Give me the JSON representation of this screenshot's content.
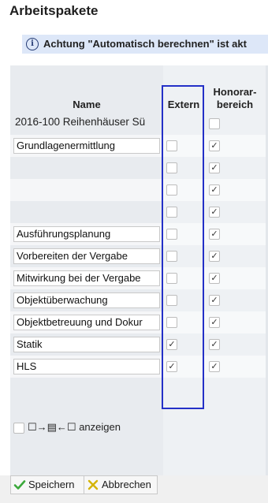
{
  "panel": {
    "title": "Arbeitspakete"
  },
  "info": {
    "icon": "info-icon",
    "text": "Achtung \"Automatisch berechnen\" ist akt"
  },
  "table": {
    "headers": {
      "name": "Name",
      "extern": "Extern",
      "honorar": "Honorar-\nbereich"
    },
    "rows": [
      {
        "name": "2016-100 Reihenhäuser Sü",
        "editable": false,
        "extern": false,
        "honorar": false
      },
      {
        "name": "Grundlagenermittlung",
        "editable": true,
        "extern": false,
        "honorar": true
      },
      {
        "name": "",
        "editable": false,
        "extern": false,
        "honorar": true
      },
      {
        "name": "",
        "editable": false,
        "extern": false,
        "honorar": true
      },
      {
        "name": "",
        "editable": false,
        "extern": false,
        "honorar": true
      },
      {
        "name": "Ausführungsplanung",
        "editable": true,
        "extern": false,
        "honorar": true
      },
      {
        "name": "Vorbereiten der Vergabe",
        "editable": true,
        "extern": false,
        "honorar": true
      },
      {
        "name": "Mitwirkung bei der Vergabe",
        "editable": true,
        "extern": false,
        "honorar": true
      },
      {
        "name": "Objektüberwachung",
        "editable": true,
        "extern": false,
        "honorar": true
      },
      {
        "name": "Objektbetreuung und Dokur",
        "editable": true,
        "extern": false,
        "honorar": true
      },
      {
        "name": "Statik",
        "editable": true,
        "extern": true,
        "honorar": true
      },
      {
        "name": "HLS",
        "editable": true,
        "extern": true,
        "honorar": true
      }
    ]
  },
  "options": {
    "show_label": "☐→▤←☐ anzeigen",
    "show_checked": false
  },
  "footer": {
    "save_label": "Speichern",
    "cancel_label": "Abbrechen"
  },
  "colors": {
    "highlight": "#2430c7",
    "info_bg": "#dde7f8",
    "save_icon": "#3aa83a",
    "cancel_icon": "#e2c200"
  }
}
